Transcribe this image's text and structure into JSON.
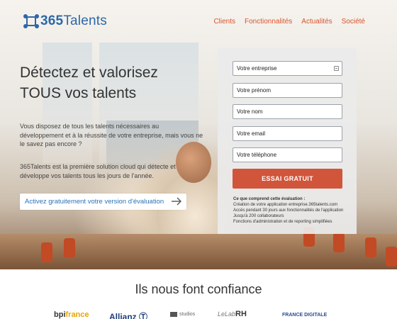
{
  "brand": {
    "logo_text_prefix": "365",
    "logo_text_suffix": "Talents"
  },
  "nav": {
    "items": [
      "Clients",
      "Fonctionnalités",
      "Actualités",
      "Société"
    ]
  },
  "hero": {
    "headline_line1": "Détectez et valorisez",
    "headline_line2": "TOUS vos talents",
    "paragraph1": "Vous disposez de tous les talents nécessaires au développement et à la réussite de votre entreprise, mais vous ne le savez pas encore ?",
    "paragraph2": "365Talents est la première solution cloud qui détecte et développe vos talents tous les jours de l'année.",
    "cta_label": "Activez gratuitement votre version d'évaluation"
  },
  "form": {
    "fields": [
      {
        "placeholder": "Votre entreprise"
      },
      {
        "placeholder": "Votre prénom"
      },
      {
        "placeholder": "Votre nom"
      },
      {
        "placeholder": "Votre email"
      },
      {
        "placeholder": "Votre téléphone"
      }
    ],
    "submit_label": "ESSAI GRATUIT",
    "info_title": "Ce que comprend cette évaluation :",
    "info_lines": [
      "Création de votre application entreprise.365talents.com",
      "Accès pendant 30 jours aux fonctionnalités de l'application",
      "Jusqu'à 200 collaborateurs",
      "Fonctions d'administration et de reporting simplifiées"
    ]
  },
  "trust": {
    "title": "Ils nous font confiance",
    "logos": {
      "bpi_a": "bpi",
      "bpi_b": "france",
      "allianz": "Allianz",
      "studios": "studios",
      "lelab_a": "LeLab",
      "lelab_b": "RH",
      "ftdigitale": "FRANCE DIGITALE"
    }
  },
  "colors": {
    "brand_blue": "#2d67a8",
    "accent_orange": "#d9542a",
    "button_red": "#d1553a",
    "link_blue": "#2b72b8"
  }
}
